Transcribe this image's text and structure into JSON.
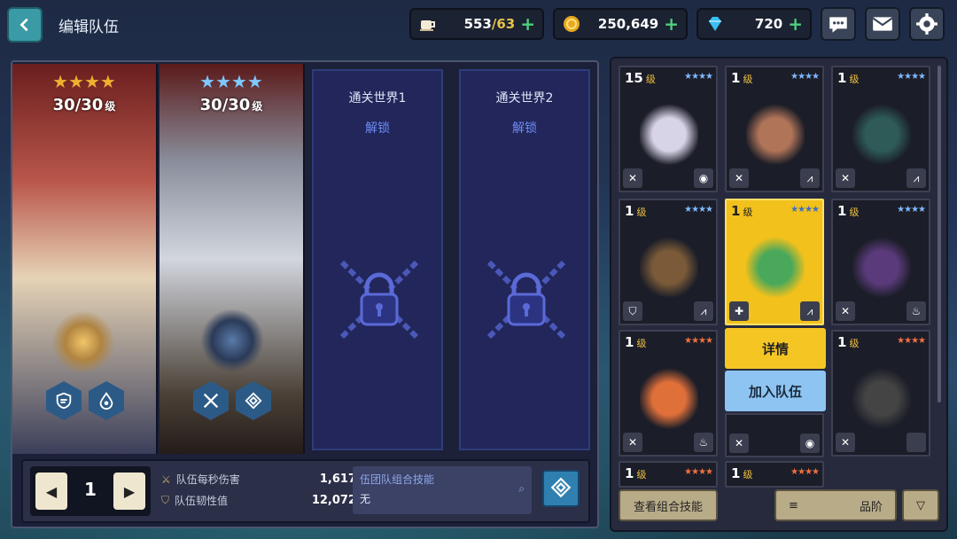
{
  "header": {
    "title": "编辑队伍",
    "stamina": "553",
    "stamina_max": "/63",
    "gold": "250,649",
    "gems": "720",
    "icons": [
      "coffee-icon",
      "coin-icon",
      "diamond-icon",
      "chat-icon",
      "mail-icon",
      "gear-icon"
    ]
  },
  "team": {
    "heroes": [
      {
        "stars": "★★★★",
        "level": "30/30",
        "level_unit": "级",
        "star_color": "#f0b030"
      },
      {
        "stars": "★★★★",
        "level": "30/30",
        "level_unit": "级",
        "star_color": "#7fc8ff"
      }
    ],
    "locked_slots": [
      {
        "title": "通关世界1",
        "unlock": "解锁"
      },
      {
        "title": "通关世界2",
        "unlock": "解锁"
      }
    ],
    "page": "1",
    "stats": [
      {
        "label": "队伍每秒伤害",
        "value": "1,617"
      },
      {
        "label": "队伍韧性值",
        "value": "12,072"
      }
    ],
    "combo": {
      "label": "伍团队组合技能",
      "value": "无"
    }
  },
  "roster": {
    "cards": [
      {
        "level": "15",
        "unit": "级",
        "stars": "★★★★",
        "star_color": "#7fb8ff",
        "sprite_color": "#d8d4e8"
      },
      {
        "level": "1",
        "unit": "级",
        "stars": "★★★★",
        "star_color": "#7fb8ff",
        "sprite_color": "#b07458"
      },
      {
        "level": "1",
        "unit": "级",
        "stars": "★★★★",
        "star_color": "#7fb8ff",
        "sprite_color": "#2e5a58"
      },
      {
        "level": "1",
        "unit": "级",
        "stars": "★★★★",
        "star_color": "#7fb8ff",
        "sprite_color": "#7a5a38"
      },
      {
        "level": "1",
        "unit": "级",
        "stars": "★★★★",
        "star_color": "#3a70c0",
        "sprite_color": "#4aa85a"
      },
      {
        "level": "1",
        "unit": "级",
        "stars": "★★★★",
        "star_color": "#7fb8ff",
        "sprite_color": "#5a3a7a"
      },
      {
        "level": "1",
        "unit": "级",
        "stars": "★★★★",
        "star_color": "#f07040",
        "sprite_color": "#e0703a"
      },
      {
        "level": "1",
        "unit": "级",
        "stars": "★★★★",
        "star_color": "#f07040",
        "sprite_color": "#a05a8a"
      },
      {
        "level": "1",
        "unit": "级",
        "stars": "★★★★",
        "star_color": "#f07040",
        "sprite_color": "#444"
      },
      {
        "level": "1",
        "unit": "级",
        "stars": "★★★★",
        "star_color": "#f07040",
        "sprite_color": "#444"
      },
      {
        "level": "1",
        "unit": "级",
        "stars": "★★★★",
        "star_color": "#f07040",
        "sprite_color": "#444"
      }
    ],
    "popup": {
      "details": "详情",
      "join": "加入队伍"
    },
    "combo_button": "查看组合技能",
    "sort_label": "品阶"
  }
}
